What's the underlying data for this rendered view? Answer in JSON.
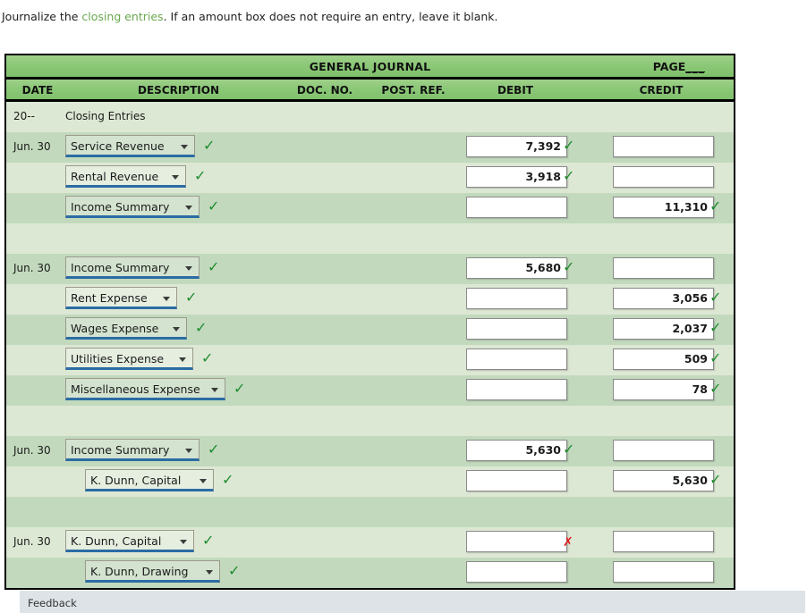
{
  "prompt": {
    "before": "Journalize the ",
    "link": "closing entries",
    "after": ". If an amount box does not require an entry, leave it blank."
  },
  "journal": {
    "title": "GENERAL JOURNAL",
    "page_label": "PAGE",
    "page_blank": "___",
    "columns": {
      "date": "DATE",
      "description": "DESCRIPTION",
      "doc_no": "DOC. NO.",
      "post_ref": "POST. REF.",
      "debit": "DEBIT",
      "credit": "CREDIT"
    },
    "rows": [
      {
        "kind": "text",
        "date": "20--",
        "text": "Closing Entries"
      },
      {
        "kind": "entry",
        "date": "Jun. 30",
        "account": "Service Revenue",
        "indent": 0,
        "sel_width": 145,
        "sel_mark": "check",
        "debit": "7,392",
        "debit_mark": "check",
        "credit": "",
        "credit_mark": ""
      },
      {
        "kind": "entry",
        "date": "",
        "account": "Rental Revenue",
        "indent": 0,
        "sel_width": 135,
        "sel_mark": "check",
        "debit": "3,918",
        "debit_mark": "check",
        "credit": "",
        "credit_mark": ""
      },
      {
        "kind": "entry",
        "date": "",
        "account": "Income Summary",
        "indent": 0,
        "sel_width": 150,
        "sel_mark": "check",
        "debit": "",
        "debit_mark": "",
        "credit": "11,310",
        "credit_mark": "check"
      },
      {
        "kind": "blank",
        "date": "",
        "text": ""
      },
      {
        "kind": "entry",
        "date": "Jun. 30",
        "account": "Income Summary",
        "indent": 0,
        "sel_width": 150,
        "sel_mark": "check",
        "debit": "5,680",
        "debit_mark": "check",
        "credit": "",
        "credit_mark": ""
      },
      {
        "kind": "entry",
        "date": "",
        "account": "Rent Expense",
        "indent": 0,
        "sel_width": 125,
        "sel_mark": "check",
        "debit": "",
        "debit_mark": "",
        "credit": "3,056",
        "credit_mark": "check"
      },
      {
        "kind": "entry",
        "date": "",
        "account": "Wages Expense",
        "indent": 0,
        "sel_width": 136,
        "sel_mark": "check",
        "debit": "",
        "debit_mark": "",
        "credit": "2,037",
        "credit_mark": "check"
      },
      {
        "kind": "entry",
        "date": "",
        "account": "Utilities Expense",
        "indent": 0,
        "sel_width": 143,
        "sel_mark": "check",
        "debit": "",
        "debit_mark": "",
        "credit": "509",
        "credit_mark": "check"
      },
      {
        "kind": "entry",
        "date": "",
        "account": "Miscellaneous Expense",
        "indent": 0,
        "sel_width": 179,
        "sel_mark": "check",
        "debit": "",
        "debit_mark": "",
        "credit": "78",
        "credit_mark": "check"
      },
      {
        "kind": "blank",
        "date": "",
        "text": ""
      },
      {
        "kind": "entry",
        "date": "Jun. 30",
        "account": "Income Summary",
        "indent": 0,
        "sel_width": 150,
        "sel_mark": "check",
        "debit": "5,630",
        "debit_mark": "check",
        "credit": "",
        "credit_mark": ""
      },
      {
        "kind": "entry",
        "date": "",
        "account": "K. Dunn, Capital",
        "indent": 22,
        "sel_width": 144,
        "sel_mark": "check",
        "debit": "",
        "debit_mark": "",
        "credit": "5,630",
        "credit_mark": "check"
      },
      {
        "kind": "blank",
        "date": "",
        "text": ""
      },
      {
        "kind": "entry",
        "date": "Jun. 30",
        "account": "K. Dunn, Capital",
        "indent": 0,
        "sel_width": 144,
        "sel_mark": "check",
        "debit": "",
        "debit_mark": "cross",
        "credit": "",
        "credit_mark": ""
      },
      {
        "kind": "entry",
        "date": "",
        "account": "K. Dunn, Drawing",
        "indent": 22,
        "sel_width": 151,
        "sel_mark": "check",
        "debit": "",
        "debit_mark": "",
        "credit": "",
        "credit_mark": ""
      }
    ]
  },
  "feedback": {
    "label": "Feedback"
  },
  "marks": {
    "check": "✓",
    "cross": "✗"
  },
  "colors": {
    "link": "#6aa84f",
    "header_green": "#8cc878",
    "row_light": "#dde8d4",
    "row_dark": "#c2d9bd",
    "check_green": "#1e8c2e",
    "cross_red": "#e01b1b",
    "select_underline": "#2b6ca3",
    "feedback_bg": "#dde3e7"
  }
}
